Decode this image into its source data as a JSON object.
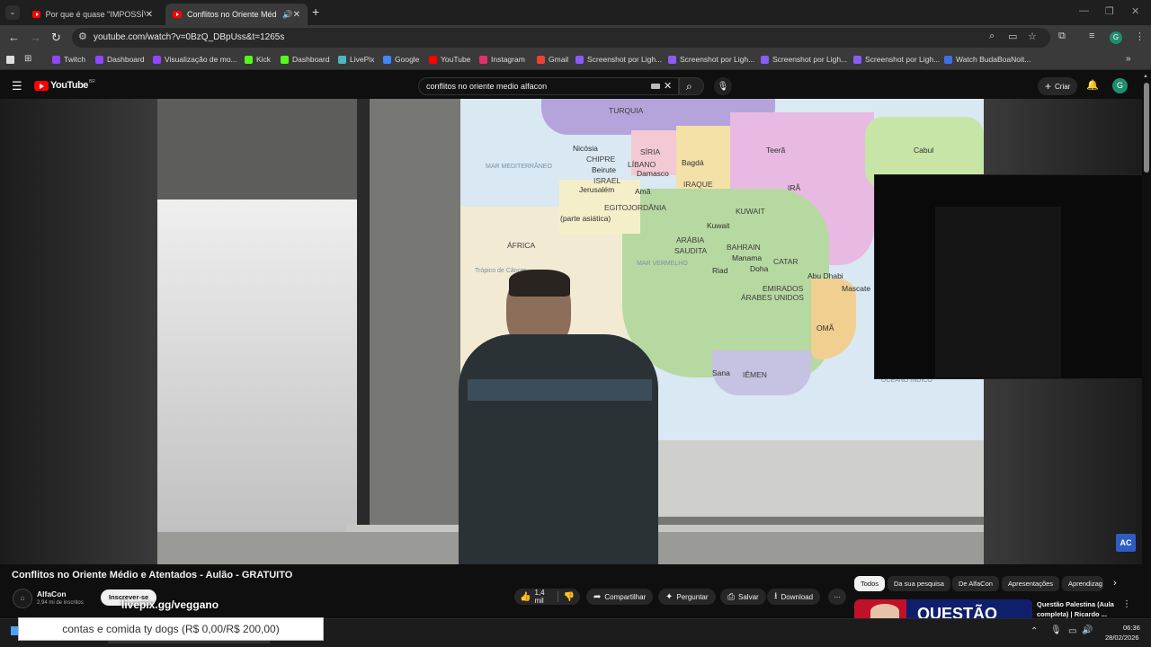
{
  "browser": {
    "tabs": [
      {
        "title": "Por que é quase \"IMPOSSÍVEL\"",
        "active": false
      },
      {
        "title": "Conflitos no Oriente Médio",
        "active": true
      }
    ],
    "new_tab": "+",
    "url": "youtube.com/watch?v=0BzQ_DBpUss&t=1265s",
    "bookmarks": [
      {
        "label": "Twitch",
        "color": "#9146ff"
      },
      {
        "label": "Dashboard",
        "color": "#9146ff"
      },
      {
        "label": "Visualização de mo...",
        "color": "#9146ff"
      },
      {
        "label": "Kick",
        "color": "#53fc18"
      },
      {
        "label": "Dashboard",
        "color": "#53fc18"
      },
      {
        "label": "LivePix",
        "color": "#4cb6c4"
      },
      {
        "label": "Google",
        "color": "#4285f4"
      },
      {
        "label": "YouTube",
        "color": "#ff0000"
      },
      {
        "label": "Instagram",
        "color": "#e1306c"
      },
      {
        "label": "Gmail",
        "color": "#ea4335"
      },
      {
        "label": "Screenshot por Ligh...",
        "color": "#8a5cf5"
      },
      {
        "label": "Screenshot por Ligh...",
        "color": "#8a5cf5"
      },
      {
        "label": "Screenshot por Ligh...",
        "color": "#8a5cf5"
      },
      {
        "label": "Screenshot por Ligh...",
        "color": "#8a5cf5"
      },
      {
        "label": "Watch BudaBoaNoit...",
        "color": "#3f6fe5"
      }
    ],
    "profile_initial": "G"
  },
  "youtube": {
    "logo": "YouTube",
    "logo_suffix": "BR",
    "search_query": "conflitos no oriente medio alfacon",
    "create_label": "Criar",
    "avatar_initial": "G"
  },
  "video": {
    "title": "Conflitos no Oriente Médio e Atentados - Aulão - GRATUITO",
    "channel": "AlfaCon",
    "subscribers": "2,94 mi de inscritos",
    "subscribe_label": "Inscrever-se",
    "likes": "1,4 mil",
    "share_label": "Compartilhar",
    "ask_label": "Perguntar",
    "save_label": "Salvar",
    "download_label": "Download",
    "channel_badge": "AC",
    "map_labels": [
      "TURQUIA",
      "SÍRIA",
      "Nicósia",
      "CHIPRE",
      "Beirute",
      "LÍBANO",
      "Damasco",
      "Bagdá",
      "Teerã",
      "Cabul",
      "ISRAEL",
      "Jerusalém",
      "Amã",
      "IRAQUE",
      "IRÃ",
      "MAR MEDITERRÂNEO",
      "EGITO",
      "(parte asiática)",
      "JORDÂNIA",
      "KUWAIT",
      "Kuwait",
      "ÁFRICA",
      "ARÁBIA",
      "SAUDITA",
      "BAHRAIN",
      "Manama",
      "CATAR",
      "Doha",
      "Riad",
      "Abu Dhabi",
      "EMIRADOS",
      "ÁRABES UNIDOS",
      "Mascate",
      "OMÃ",
      "Sana",
      "IÊMEN",
      "OCEANO ÍNDICO",
      "Trópico de Câncer",
      "MAR VERMELHO"
    ]
  },
  "chips": [
    "Todos",
    "Da sua pesquisa",
    "De AlfaCon",
    "Apresentações",
    "Aprendizag"
  ],
  "recommendation": {
    "title_line1": "Questão Palestina (Aula",
    "title_line2": "completa) | Ricardo ...",
    "thumb_text": "QUESTÃO"
  },
  "overlay": {
    "livepix_text": "livepix.gg/veggano",
    "donation_text": "contas e comida ty dogs (R$ 0,00/R$ 200,00)"
  },
  "taskbar": {
    "time": "06:36",
    "date": "28/02/2026"
  }
}
